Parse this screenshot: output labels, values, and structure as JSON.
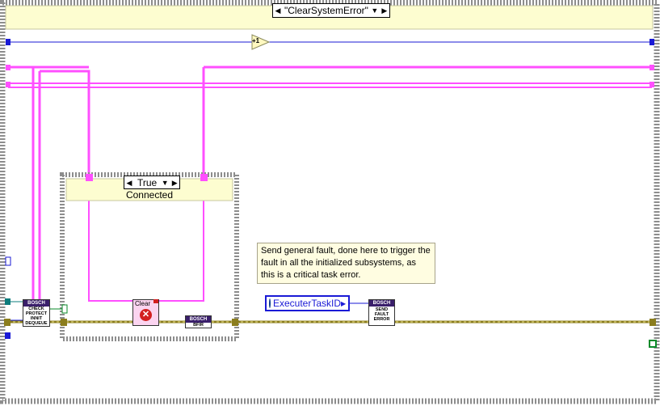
{
  "outer_case": {
    "selector_label": "\"ClearSystemError\""
  },
  "increment_node": {
    "label": "+1"
  },
  "inner_case": {
    "selector_label": "True",
    "frame_label": "Connected"
  },
  "check_dequeue_vi": {
    "header": "BOSCH",
    "lines": [
      "CHECK",
      "PROTECT",
      "INNIT",
      "DEQUEUE"
    ]
  },
  "clear_vi": {
    "label": "Clear"
  },
  "bosch_fifo_vi": {
    "header": "BOSCH",
    "lines": [
      "BFIR"
    ]
  },
  "send_fault_vi": {
    "header": "BOSCH",
    "lines": [
      "SEND",
      "FAULT",
      "ERROR"
    ]
  },
  "task_id_constant": {
    "label": "ExecuterTaskID"
  },
  "comment": {
    "text": "Send general fault, done here to trigger the fault in all the initialized subsystems, as this is a critical task error."
  },
  "colors": {
    "error_wire": "#8b7d1e",
    "ref_wire": "#ff4fff",
    "int_wire": "#1a1ad6",
    "frame_gray": "#9a9a9a",
    "frame_header": "#fdfdd0"
  }
}
